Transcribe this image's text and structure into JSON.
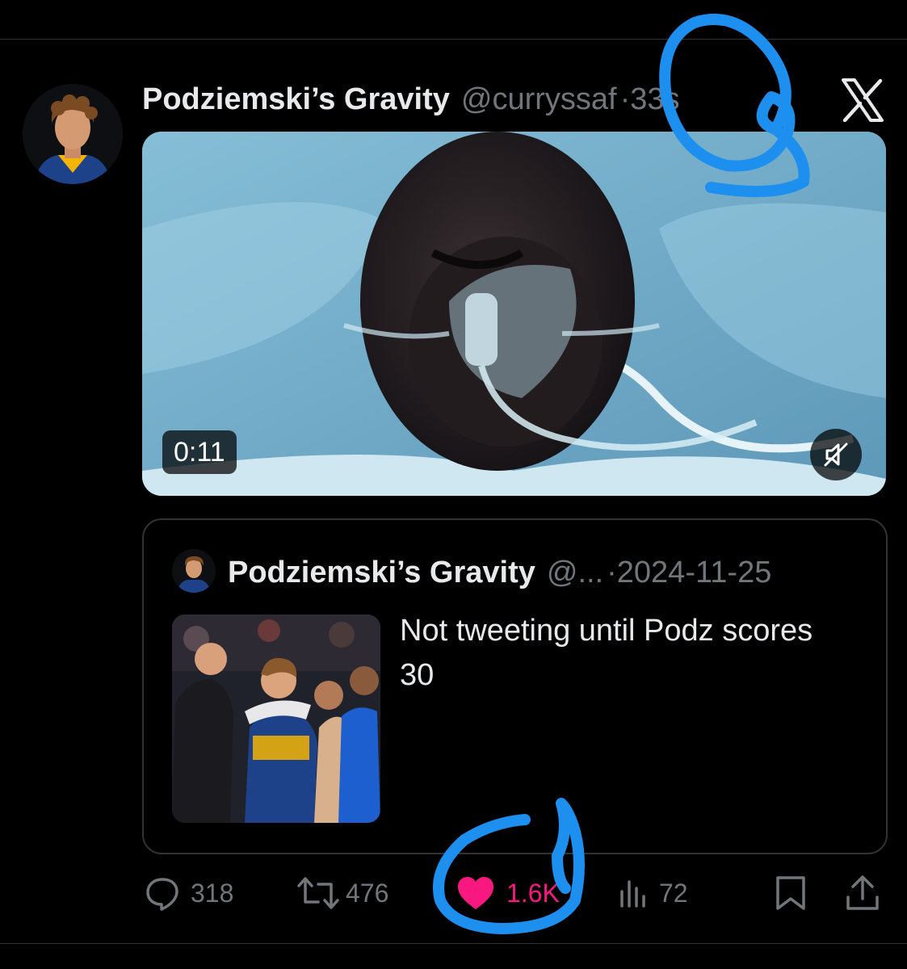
{
  "post": {
    "display_name": "Podziemski’s Gravity",
    "handle": "@curryssaf",
    "time": "·33s",
    "video": {
      "duration": "0:11",
      "mute_icon": "speaker-muted-icon"
    },
    "quoted": {
      "display_name": "Podziemski’s Gravity",
      "handle": "@...",
      "date": "·2024-11-25",
      "text": "Not tweeting until Podz scores 30"
    },
    "actions": {
      "replies": "318",
      "reposts": "476",
      "likes": "1.6K",
      "views": "72"
    }
  },
  "colors": {
    "background": "#000000",
    "text_primary": "#e7e9ea",
    "text_secondary": "#71767b",
    "like_pink": "#f91880",
    "annotation_blue": "#1d8fef"
  }
}
